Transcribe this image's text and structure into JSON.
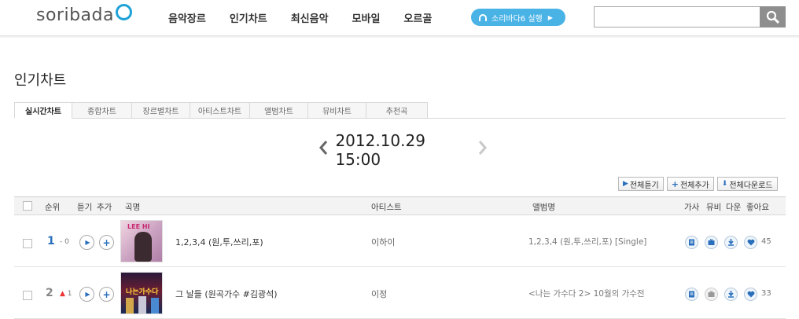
{
  "header": {
    "logo_text": "soribada",
    "nav": [
      "음악장르",
      "인기차트",
      "최신음악",
      "모바일",
      "오르골"
    ],
    "run_button": "소리바다6 실행",
    "search": {
      "value": "",
      "placeholder": ""
    },
    "brand_color": "#1ea2d8"
  },
  "page": {
    "title": "인기차트",
    "tabs": [
      "실시간차트",
      "종합차트",
      "장르별차트",
      "아티스트차트",
      "앨범차트",
      "뮤비차트",
      "추천곡"
    ],
    "active_tab": "실시간차트",
    "date": "2012.10.29 15:00"
  },
  "actions": [
    "전체듣기",
    "전체추가",
    "전체다운로드"
  ],
  "table": {
    "headers": {
      "rank": "순위",
      "listen": "듣기",
      "add": "추가",
      "title": "곡명",
      "artist": "아티스트",
      "album": "앨범명",
      "lyrics": "가사",
      "mv": "뮤비",
      "download": "다운",
      "like": "좋아요"
    },
    "rows": [
      {
        "rank": "1",
        "change_sym": "-",
        "change_val": "0",
        "title": "1,2,3,4 (원,투,쓰리,포)",
        "artist": "이하이",
        "album": "1,2,3,4 (원,투,쓰리,포) [Single]",
        "likes": "45",
        "art_text": "LEE HI"
      },
      {
        "rank": "2",
        "change_sym": "▲",
        "change_val": "1",
        "title": "그 날들 (원곡가수 #김광석)",
        "artist": "이정",
        "album": "<나는 가수다 2> 10월의 가수전",
        "likes": "33",
        "art_text": "나는가수다"
      }
    ]
  }
}
